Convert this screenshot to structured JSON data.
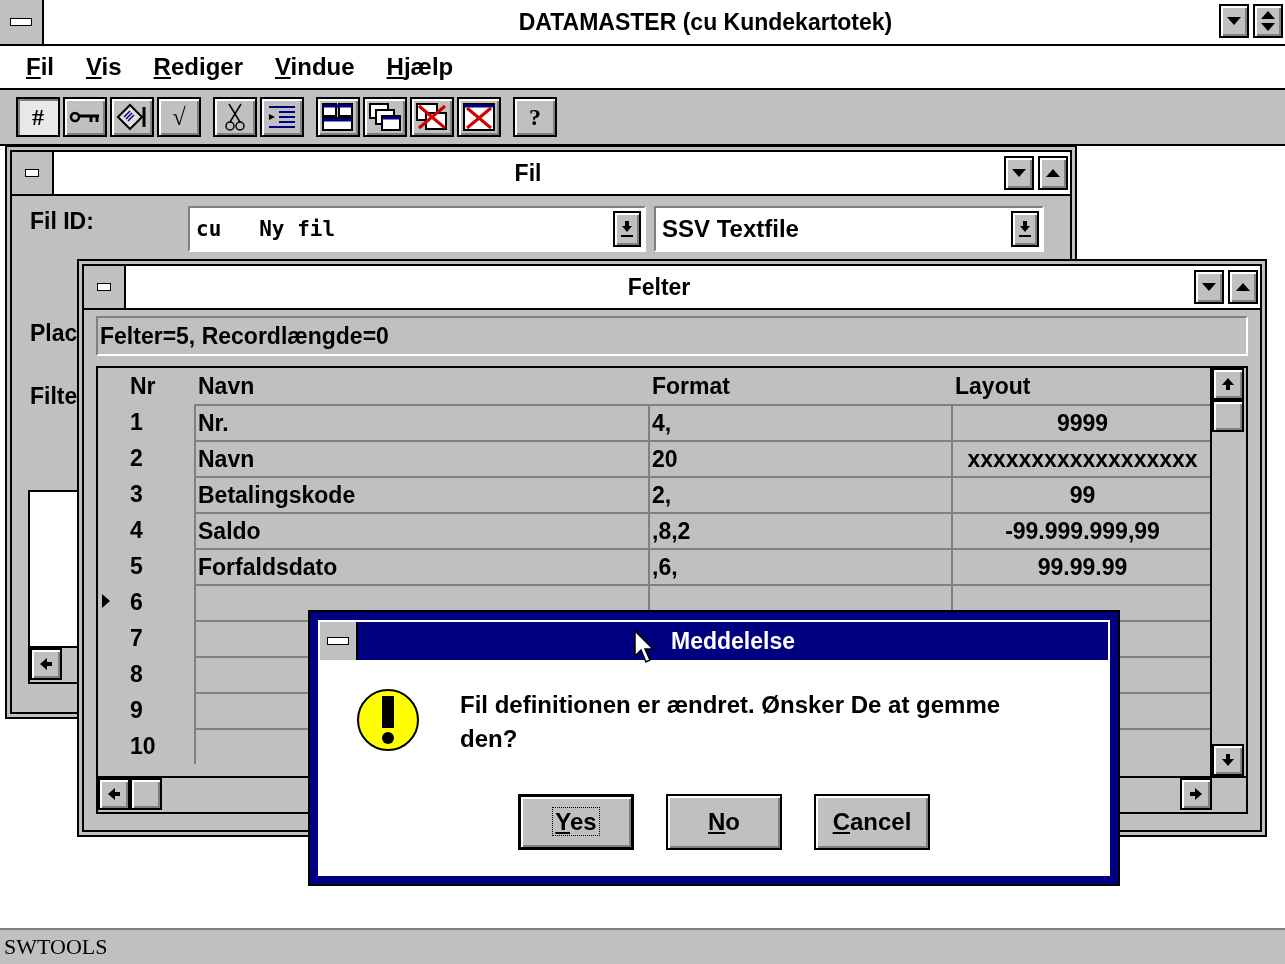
{
  "app": {
    "title": "DATAMASTER (cu Kundekartotek)"
  },
  "menu": [
    "Fil",
    "Vis",
    "Rediger",
    "Vindue",
    "Hjælp"
  ],
  "toolbar": [
    [
      {
        "kind": "glyph",
        "text": "#",
        "pressed": true
      },
      {
        "kind": "key",
        "pressed": false
      },
      {
        "kind": "form",
        "pressed": false
      },
      {
        "kind": "glyph",
        "text": "√",
        "pressed": false
      }
    ],
    [
      {
        "kind": "scissors",
        "pressed": false
      },
      {
        "kind": "lines",
        "pressed": false
      }
    ],
    [
      {
        "kind": "tile",
        "pressed": false
      },
      {
        "kind": "cascade",
        "pressed": false
      },
      {
        "kind": "close-all",
        "pressed": false
      },
      {
        "kind": "close-one",
        "pressed": false
      }
    ],
    [
      {
        "kind": "glyph",
        "text": "?",
        "pressed": false
      }
    ]
  ],
  "fil_window": {
    "title": "Fil",
    "id_label": "Fil ID:",
    "id_value": "cu   Ny fil",
    "type_value": "SSV Textfile",
    "label_2": "Plac",
    "label_3": "Filte"
  },
  "felter_window": {
    "title": "Felter",
    "info": "Felter=5, Recordlængde=0",
    "columns": [
      "Nr",
      "Navn",
      "Format",
      "Layout"
    ],
    "rows": [
      {
        "nr": "1",
        "navn": "Nr.",
        "format": "4,",
        "layout": "9999",
        "current": false
      },
      {
        "nr": "2",
        "navn": "Navn",
        "format": "20",
        "layout": "xxxxxxxxxxxxxxxxxx",
        "current": false
      },
      {
        "nr": "3",
        "navn": "Betalingskode",
        "format": "2,",
        "layout": "99",
        "current": false
      },
      {
        "nr": "4",
        "navn": "Saldo",
        "format": ",8,2",
        "layout": "-99.999.999,99",
        "current": false
      },
      {
        "nr": "5",
        "navn": "Forfaldsdato",
        "format": ",6,",
        "layout": "99.99.99",
        "current": false
      },
      {
        "nr": "6",
        "navn": "",
        "format": "",
        "layout": "",
        "current": true
      },
      {
        "nr": "7",
        "navn": "",
        "format": "",
        "layout": "",
        "current": false
      },
      {
        "nr": "8",
        "navn": "",
        "format": "",
        "layout": "",
        "current": false
      },
      {
        "nr": "9",
        "navn": "",
        "format": "",
        "layout": "",
        "current": false
      },
      {
        "nr": "10",
        "navn": "",
        "format": "",
        "layout": "",
        "current": false
      }
    ]
  },
  "dialog": {
    "title": "Meddelelse",
    "message": "Fil definitionen er ændret. Ønsker De at gemme den?",
    "buttons": [
      {
        "label": "Yes",
        "default": true
      },
      {
        "label": "No",
        "default": false
      },
      {
        "label": "Cancel",
        "default": false
      }
    ]
  },
  "status_bar": {
    "text": "SWTOOLS"
  }
}
